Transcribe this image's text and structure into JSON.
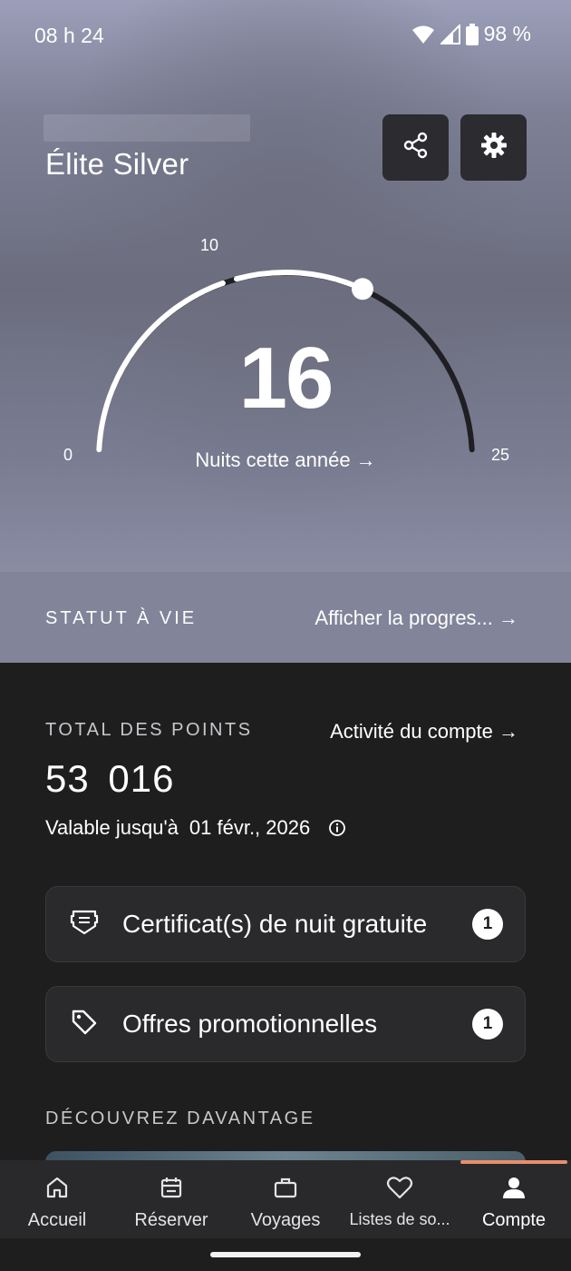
{
  "status_bar": {
    "time": "08 h 24",
    "battery": "98 %",
    "icons": [
      "wifi-icon",
      "cell-signal-icon",
      "battery-icon"
    ]
  },
  "header": {
    "tier": "Élite Silver",
    "share_icon": "share-icon",
    "settings_icon": "gear-icon"
  },
  "gauge": {
    "value": "16",
    "nights": 16,
    "caption": "Nuits cette année →",
    "ticks": [
      "0",
      "10",
      "25"
    ],
    "min": 0,
    "max": 25,
    "milestone": 10
  },
  "lifetime": {
    "label": "STATUT À VIE",
    "link": "Afficher la progres... →"
  },
  "points": {
    "label": "TOTAL DES POINTS",
    "activity_link": "Activité du compte →",
    "value": "53 016",
    "valid_prefix": "Valable jusqu'à",
    "valid_date": "01 févr., 2026"
  },
  "cards": [
    {
      "label": "Certificat(s) de nuit gratuite",
      "badge": "1",
      "icon": "certificate-icon"
    },
    {
      "label": "Offres promotionnelles",
      "badge": "1",
      "icon": "tag-icon"
    }
  ],
  "discover": {
    "label": "DÉCOUVREZ DAVANTAGE"
  },
  "nav": [
    {
      "label": "Accueil",
      "icon": "home-icon"
    },
    {
      "label": "Réserver",
      "icon": "calendar-icon"
    },
    {
      "label": "Voyages",
      "icon": "briefcase-icon"
    },
    {
      "label": "Listes de so...",
      "icon": "heart-icon"
    },
    {
      "label": "Compte",
      "icon": "person-icon"
    }
  ],
  "colors": {
    "accent": "#e88e6a",
    "panel": "#1e1e1f",
    "card": "#2a2a2c"
  }
}
